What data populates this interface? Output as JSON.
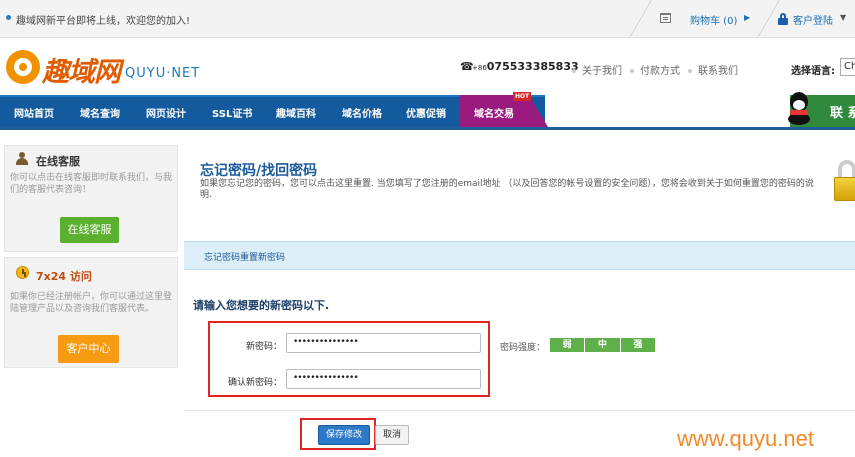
{
  "topbar": {
    "notice": "趣域网新平台即将上线，欢迎您的加入!",
    "cart": "购物车 (0)",
    "login": "客户登陆"
  },
  "header": {
    "logo_cn": "趣域网",
    "logo_en": "QUYU·NET",
    "phone_prefix": "+86",
    "phone": "075533385833",
    "links": [
      "关于我们",
      "付款方式",
      "联系我们"
    ],
    "lang_label": "选择语言:",
    "lang_value": "Ch"
  },
  "nav": {
    "items": [
      "网站首页",
      "域名查询",
      "网页设计",
      "SSL证书",
      "趣域百科",
      "域名价格",
      "优惠促销",
      "域名交易"
    ],
    "hot_badge": "HOT",
    "qq_text": "联 系"
  },
  "sidebar": {
    "online": {
      "title": "在线客服",
      "desc": "你可以点击在线客服即时联系我们，与我们的客服代表咨询！",
      "button": "在线客服"
    },
    "access": {
      "title": "7x24 访问",
      "desc": "如果你已经注册帐户，你可以通过这里登陆管理产品以及咨询我们客服代表。",
      "button": "客户中心"
    }
  },
  "main": {
    "title": "忘记密码/找回密码",
    "desc": "如果您忘记您的密码，您可以点击这里重置. 当您填写了您注册的email地址 （以及回答您的帐号设置的安全问题），您将会收到关于如何重置您的密码的说明.",
    "section": "忘记密码重置新密码",
    "prompt": "请输入您想要的新密码以下.",
    "new_password_label": "新密码：",
    "new_password_value": "•••••••••••••••",
    "confirm_label": "确认新密码：",
    "confirm_value": "•••••••••••••••",
    "strength_label": "密码强度：",
    "strength_levels": [
      "弱",
      "中",
      "强"
    ],
    "save_button": "保存修改",
    "cancel_button": "取消"
  },
  "watermark": "www.quyu.net"
}
